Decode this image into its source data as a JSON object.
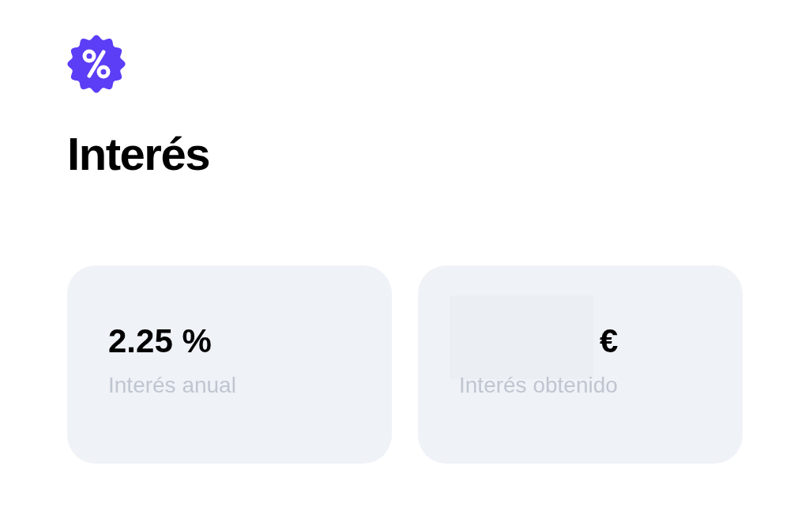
{
  "title": "Interés",
  "cards": [
    {
      "value": "2.25 %",
      "label": "Interés anual",
      "loading": false
    },
    {
      "value": "€",
      "label": "Interés obtenido",
      "loading": true
    }
  ]
}
